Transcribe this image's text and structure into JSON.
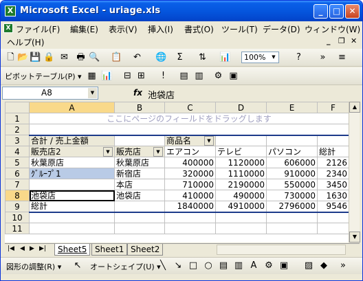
{
  "window": {
    "title": "Microsoft Excel - uriage.xls",
    "icon": "X"
  },
  "menu": {
    "items": [
      "ファイル(F)",
      "編集(E)",
      "表示(V)",
      "挿入(I)",
      "書式(O)",
      "ツール(T)",
      "データ(D)",
      "ウィンドウ(W)"
    ],
    "help": "ヘルプ(H)"
  },
  "toolbar": {
    "zoom": "100%",
    "pivot_label": "ピボットテーブル(P) ▾"
  },
  "formula": {
    "cell_ref": "A8",
    "fx": "fx",
    "value": "池袋店"
  },
  "sheet": {
    "columns": [
      "A",
      "B",
      "C",
      "D",
      "E",
      "F"
    ],
    "rows": [
      "1",
      "2",
      "3",
      "4",
      "5",
      "6",
      "7",
      "8",
      "9",
      "10",
      "11"
    ],
    "watermark": "ここにページのフィールドをドラッグします",
    "data_sum_label": "合計 / 売上金額",
    "col_field": "商品名",
    "row_field1": "販売店2",
    "row_field2": "販売店",
    "products": [
      "エアコン",
      "テレビ",
      "パソコン",
      "総計"
    ],
    "groups": [
      {
        "g": "秋葉原店",
        "store": "秋葉原店",
        "vals": [
          "400000",
          "1120000",
          "606000",
          "2126"
        ]
      },
      {
        "g": "ｸﾞﾙｰﾌﾟ1",
        "store": "新宿店",
        "vals": [
          "320000",
          "1110000",
          "910000",
          "2340"
        ]
      },
      {
        "g": "",
        "store": "本店",
        "vals": [
          "710000",
          "2190000",
          "550000",
          "3450"
        ]
      },
      {
        "g": "池袋店",
        "store": "池袋店",
        "vals": [
          "410000",
          "490000",
          "730000",
          "1630"
        ]
      }
    ],
    "total_label": "総計",
    "total_vals": [
      "1840000",
      "4910000",
      "2796000",
      "9546"
    ]
  },
  "tabs": [
    "Sheet5",
    "Sheet1",
    "Sheet2"
  ],
  "drawbar": {
    "adjust": "図形の調整(R) ▾",
    "autoshape": "オートシェイプ(U) ▾"
  }
}
